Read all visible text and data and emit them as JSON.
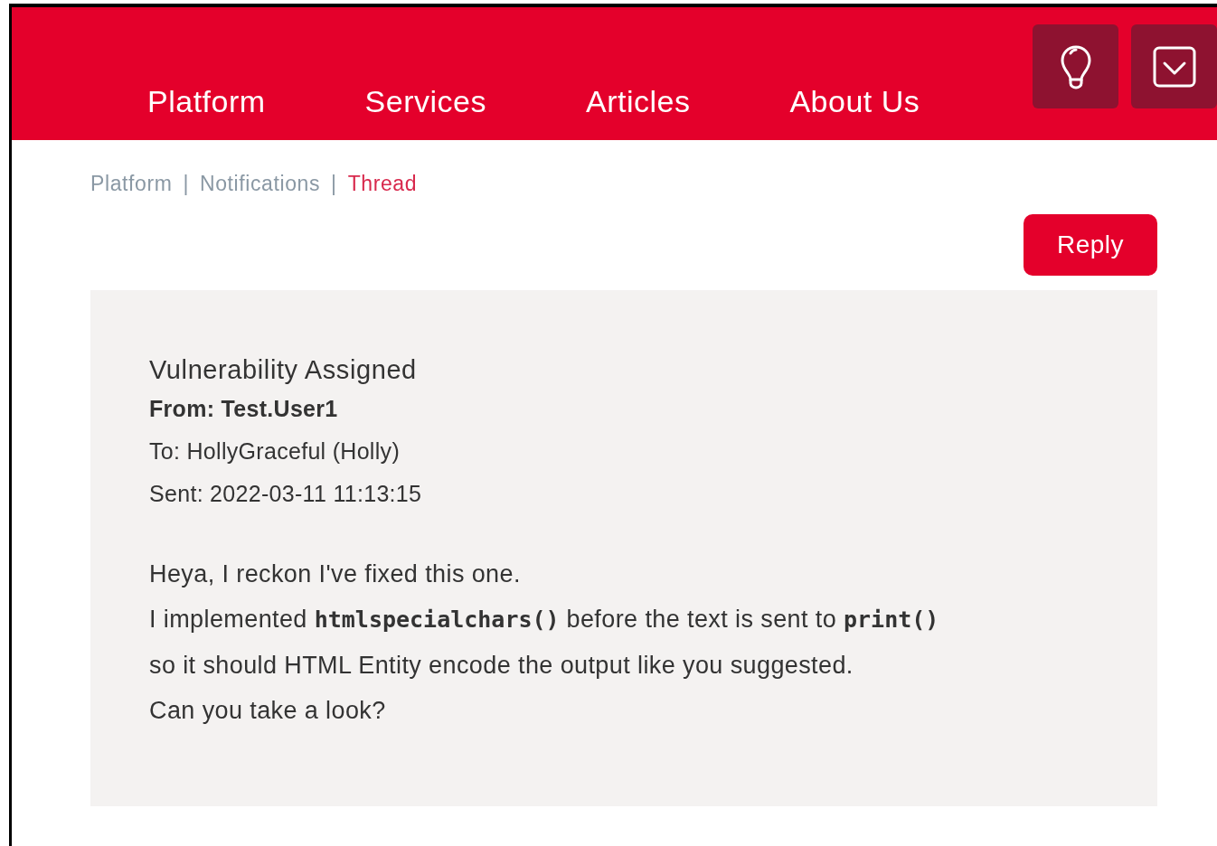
{
  "nav": {
    "items": [
      {
        "label": "Platform"
      },
      {
        "label": "Services"
      },
      {
        "label": "Articles"
      },
      {
        "label": "About Us"
      }
    ],
    "icon_buttons": [
      {
        "kind": "bulb"
      },
      {
        "kind": "inbox"
      }
    ]
  },
  "breadcrumb": [
    {
      "label": "Platform",
      "selected": false
    },
    {
      "separator": "|",
      "label": "Notifications",
      "selected": false
    },
    {
      "separator": "|",
      "label": "Thread",
      "selected": true
    }
  ],
  "reply_button": "Reply",
  "message": {
    "subject": "Vulnerability Assigned",
    "from": "From: Test.User1",
    "to": "To: HollyGraceful (Holly)",
    "sent": "Sent: 2022-03-11 11:13:15",
    "body": [
      [
        {
          "text": "Heya, I reckon I've fixed this one."
        }
      ],
      [
        {
          "text": "I implemented "
        },
        {
          "text": "htmlspecialchars()",
          "kind": "code"
        },
        {
          "text": " before the text is sent to "
        },
        {
          "text": "print()",
          "kind": "code"
        }
      ],
      [
        {
          "text": "so it should HTML Entity encode the output like you suggested."
        }
      ],
      [
        {
          "text": "Can you take a look?"
        }
      ]
    ]
  }
}
